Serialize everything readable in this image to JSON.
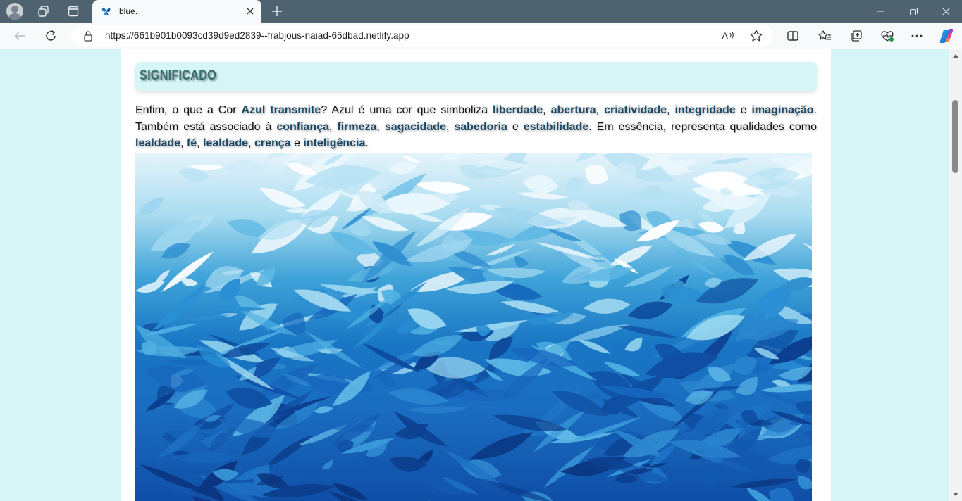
{
  "browser": {
    "tab_title": "blue.",
    "url": "https://661b901b0093cd39d9ed2839--frabjous-naiad-65dbad.netlify.app",
    "icons": [
      "profile-icon",
      "workspaces-icon",
      "tab-actions-icon",
      "favicon-butterfly-icon",
      "tab-close-icon",
      "new-tab-icon",
      "minimize-icon",
      "restore-icon",
      "window-close-icon",
      "back-icon",
      "refresh-icon",
      "lock-icon",
      "read-aloud-icon",
      "favorite-star-icon",
      "split-screen-icon",
      "favorites-icon",
      "collections-icon",
      "browser-essentials-icon",
      "more-icon",
      "copilot-icon"
    ]
  },
  "page": {
    "heading": "SIGNIFICADO",
    "paragraph": {
      "segments": [
        {
          "t": "Enfim, o que a Cor ",
          "b": false
        },
        {
          "t": "Azul transmite",
          "b": true
        },
        {
          "t": "? Azul é uma cor que simboliza ",
          "b": false
        },
        {
          "t": "liberdade",
          "b": true
        },
        {
          "t": ", ",
          "b": false
        },
        {
          "t": "abertura",
          "b": true
        },
        {
          "t": ", ",
          "b": false
        },
        {
          "t": "criatividade",
          "b": true
        },
        {
          "t": ", ",
          "b": false
        },
        {
          "t": "integridade",
          "b": true
        },
        {
          "t": " e ",
          "b": false
        },
        {
          "t": "imaginação",
          "b": true
        },
        {
          "t": ". Também está associado à ",
          "b": false
        },
        {
          "t": "confiança",
          "b": true
        },
        {
          "t": ", ",
          "b": false
        },
        {
          "t": "firmeza",
          "b": true
        },
        {
          "t": ", ",
          "b": false
        },
        {
          "t": "sagacidade",
          "b": true
        },
        {
          "t": ", ",
          "b": false
        },
        {
          "t": "sabedoria",
          "b": true
        },
        {
          "t": " e ",
          "b": false
        },
        {
          "t": "estabilidade",
          "b": true
        },
        {
          "t": ". Em essência, representa qualidades como ",
          "b": false
        },
        {
          "t": "lealdade",
          "b": true
        },
        {
          "t": ", ",
          "b": false
        },
        {
          "t": "fé",
          "b": true
        },
        {
          "t": ", ",
          "b": false
        },
        {
          "t": "lealdade",
          "b": true
        },
        {
          "t": ", ",
          "b": false
        },
        {
          "t": "crença",
          "b": true
        },
        {
          "t": " e ",
          "b": false
        },
        {
          "t": "inteligência",
          "b": true
        },
        {
          "t": ".",
          "b": false
        }
      ]
    }
  },
  "colors": {
    "page_bg": "#d6f5f6",
    "heading_text": "#3a6d6e",
    "bold_text": "#1c4a66",
    "tabstrip": "#4f6270"
  }
}
